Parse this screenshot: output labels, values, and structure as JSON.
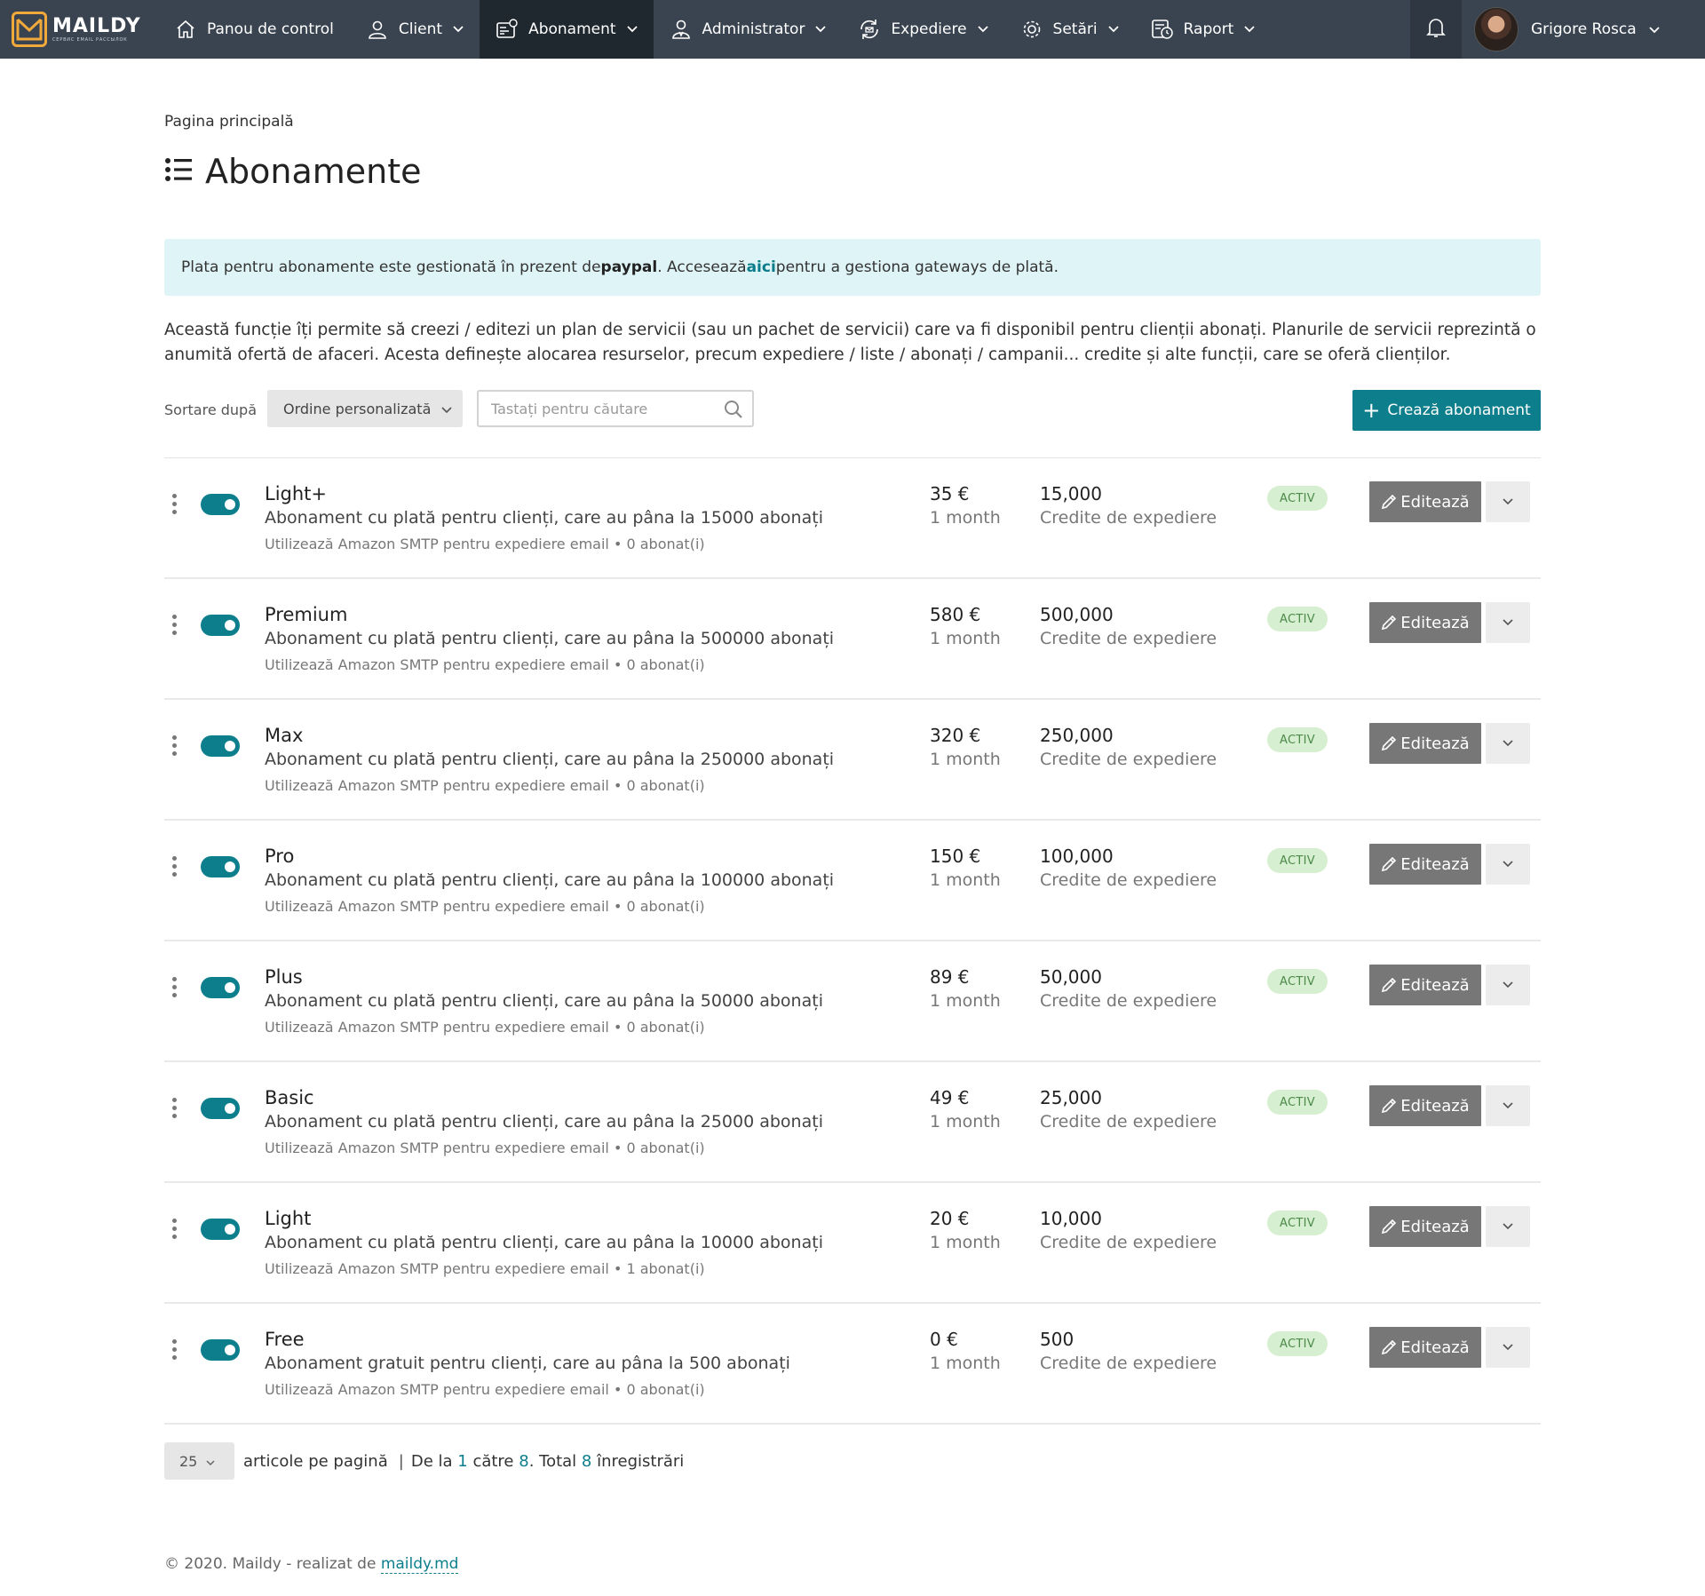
{
  "brand": {
    "name": "MAILDY",
    "tagline": "СЕРВИС EMAIL РАССЫЛОК",
    "accent_color": "#f2a93b"
  },
  "nav": {
    "items": [
      {
        "label": "Panou de control",
        "icon": "home-icon",
        "dropdown": false
      },
      {
        "label": "Client",
        "icon": "user-icon",
        "dropdown": true
      },
      {
        "label": "Abonament",
        "icon": "subscription-icon",
        "dropdown": true,
        "active": true
      },
      {
        "label": "Administrator",
        "icon": "admin-icon",
        "dropdown": true
      },
      {
        "label": "Expediere",
        "icon": "sending-icon",
        "dropdown": true
      },
      {
        "label": "Setări",
        "icon": "gear-icon",
        "dropdown": true
      },
      {
        "label": "Raport",
        "icon": "report-icon",
        "dropdown": true
      }
    ],
    "user_name": "Grigore Rosca",
    "colors": {
      "bar": "#3a4450",
      "active": "#1f272f"
    }
  },
  "breadcrumb": "Pagina principală",
  "page_title": "Abonamente",
  "alert": {
    "before": "Plata pentru abonamente este gestionată în prezent de ",
    "gateway": "paypal",
    "middle": ". Accesează ",
    "link": "aici",
    "after": " pentru a gestiona gateways de plată."
  },
  "intro": "Această funcție îți permite să creezi / editezi un plan de servicii (sau un pachet de servicii) care va fi disponibil pentru clienții abonați. Planurile de servicii reprezintă o anumită ofertă de afaceri. Acesta definește alocarea resurselor, precum expediere / liste / abonați / campanii... credite și alte funcții, care se oferă clienților.",
  "toolbar": {
    "sort_label": "Sortare după",
    "sort_value": "Ordine personalizată",
    "search_placeholder": "Tastați pentru căutare",
    "create_label": "Crează abonament"
  },
  "plans": [
    {
      "name": "Light+",
      "description": "Abonament cu plată pentru clienți, care au pâna la 15000 abonați",
      "meta": "Utilizează Amazon SMTP pentru expediere email • 0 abonat(i)",
      "price": "35 €",
      "period": "1 month",
      "credits": "15,000",
      "credits_label": "Credite de expediere",
      "status": "ACTIV",
      "edit_label": "Editează",
      "enabled": true
    },
    {
      "name": "Premium",
      "description": "Abonament cu plată pentru clienți, care au pâna la 500000 abonați",
      "meta": "Utilizează Amazon SMTP pentru expediere email • 0 abonat(i)",
      "price": "580 €",
      "period": "1 month",
      "credits": "500,000",
      "credits_label": "Credite de expediere",
      "status": "ACTIV",
      "edit_label": "Editează",
      "enabled": true
    },
    {
      "name": "Max",
      "description": "Abonament cu plată pentru clienți, care au pâna la 250000 abonați",
      "meta": "Utilizează Amazon SMTP pentru expediere email • 0 abonat(i)",
      "price": "320 €",
      "period": "1 month",
      "credits": "250,000",
      "credits_label": "Credite de expediere",
      "status": "ACTIV",
      "edit_label": "Editează",
      "enabled": true
    },
    {
      "name": "Pro",
      "description": "Abonament cu plată pentru clienți, care au pâna la 100000 abonați",
      "meta": "Utilizează Amazon SMTP pentru expediere email • 0 abonat(i)",
      "price": "150 €",
      "period": "1 month",
      "credits": "100,000",
      "credits_label": "Credite de expediere",
      "status": "ACTIV",
      "edit_label": "Editează",
      "enabled": true
    },
    {
      "name": "Plus",
      "description": "Abonament cu plată pentru clienți, care au pâna la 50000 abonați",
      "meta": "Utilizează Amazon SMTP pentru expediere email • 0 abonat(i)",
      "price": "89 €",
      "period": "1 month",
      "credits": "50,000",
      "credits_label": "Credite de expediere",
      "status": "ACTIV",
      "edit_label": "Editează",
      "enabled": true
    },
    {
      "name": "Basic",
      "description": "Abonament cu plată pentru clienți, care au pâna la 25000 abonați",
      "meta": "Utilizează Amazon SMTP pentru expediere email • 0 abonat(i)",
      "price": "49 €",
      "period": "1 month",
      "credits": "25,000",
      "credits_label": "Credite de expediere",
      "status": "ACTIV",
      "edit_label": "Editează",
      "enabled": true
    },
    {
      "name": "Light",
      "description": "Abonament cu plată pentru clienți, care au pâna la 10000 abonați",
      "meta": "Utilizează Amazon SMTP pentru expediere email • 1 abonat(i)",
      "price": "20 €",
      "period": "1 month",
      "credits": "10,000",
      "credits_label": "Credite de expediere",
      "status": "ACTIV",
      "edit_label": "Editează",
      "enabled": true
    },
    {
      "name": "Free",
      "description": "Abonament gratuit pentru clienți, care au pâna la 500 abonați",
      "meta": "Utilizează Amazon SMTP pentru expediere email • 0 abonat(i)",
      "price": "0 €",
      "period": "1 month",
      "credits": "500",
      "credits_label": "Credite de expediere",
      "status": "ACTIV",
      "edit_label": "Editează",
      "enabled": true
    }
  ],
  "pagination": {
    "per_page": "25",
    "per_page_label": "articole pe pagină",
    "from_label": "De la",
    "from": "1",
    "to_label": "către",
    "to": "8",
    "total_label": ". Total",
    "total": "8",
    "records_label": "înregistrări"
  },
  "footer": {
    "text": "© 2020. Maildy - realizat de ",
    "link": "maildy.md"
  },
  "colors": {
    "primary": "#0d7e8c",
    "alert_bg": "#dff4f7",
    "status_bg": "#d5efd0"
  }
}
